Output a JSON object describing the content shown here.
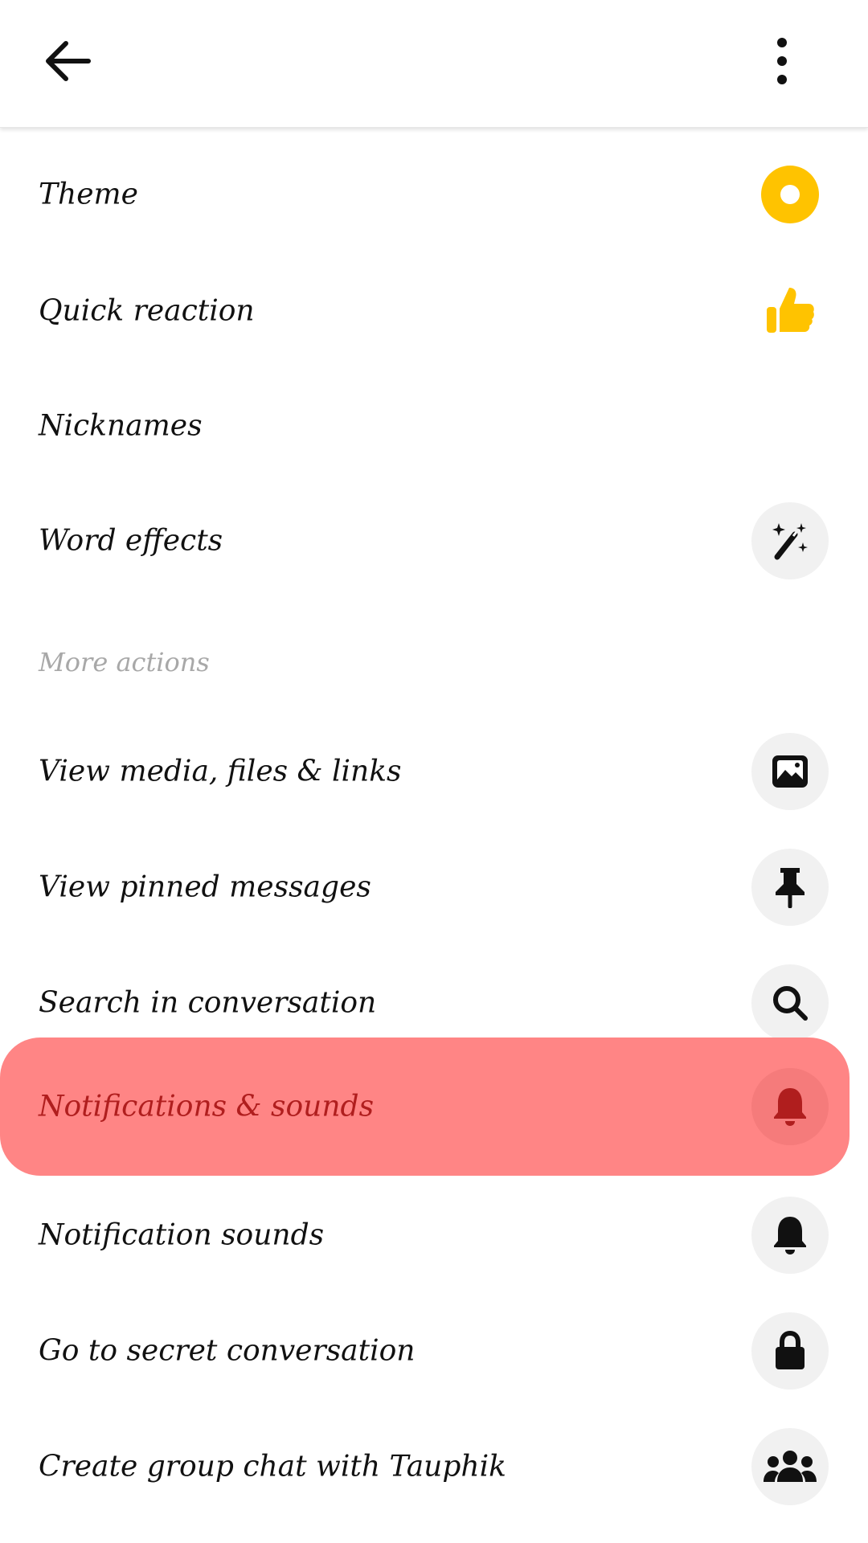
{
  "header": {
    "back_icon": "arrow-left-icon",
    "menu_icon": "more-vertical-icon"
  },
  "items": [
    {
      "label": "Theme",
      "icon": "theme-circle-icon",
      "icon_color": "#FFC300"
    },
    {
      "label": "Quick reaction",
      "icon": "thumbs-up-icon",
      "icon_color": "#FFC300"
    },
    {
      "label": "Nicknames",
      "icon": ""
    },
    {
      "label": "Word effects",
      "icon": "magic-wand-icon"
    }
  ],
  "section": {
    "title": "More actions"
  },
  "more_items": [
    {
      "label": "View media, files & links",
      "icon": "image-icon"
    },
    {
      "label": "View pinned messages",
      "icon": "pin-icon"
    },
    {
      "label": "Search in conversation",
      "icon": "search-icon"
    },
    {
      "label": "Notifications & sounds",
      "icon": "bell-icon",
      "highlighted": true
    },
    {
      "label": "Notification sounds",
      "icon": "bell-icon"
    },
    {
      "label": "Go to secret conversation",
      "icon": "lock-icon"
    },
    {
      "label": "Create group chat with Tauphik",
      "icon": "people-icon"
    }
  ],
  "colors": {
    "accent": "#FFC300",
    "highlight": "#FF8585",
    "highlight_text": "#B01E1E"
  }
}
